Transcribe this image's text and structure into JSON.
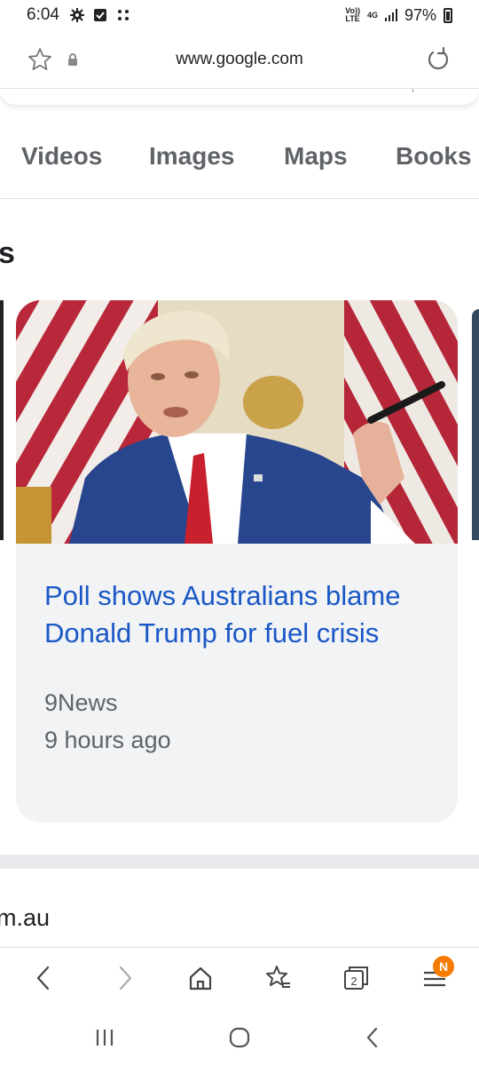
{
  "status_bar": {
    "time": "6:04",
    "network_top": "Vo))",
    "network_bottom": "LTE",
    "data_type": "4G",
    "battery": "97%",
    "icons": [
      "settings-icon",
      "checkbox-icon",
      "dots-icon",
      "signal-icon",
      "battery-icon"
    ]
  },
  "url_bar": {
    "url": "www.google.com",
    "icons": [
      "bookmark-star-icon",
      "lock-icon",
      "reload-icon"
    ]
  },
  "tabs": [
    {
      "label": "Videos"
    },
    {
      "label": "Images"
    },
    {
      "label": "Maps"
    },
    {
      "label": "Books"
    }
  ],
  "section_heading_fragment": "s",
  "news_card": {
    "title": "Poll shows Australians blame Donald Trump for fuel crisis",
    "source": "9News",
    "time": "9 hours ago",
    "image": "photo-of-man-in-blue-suit-holding-pen-before-flags"
  },
  "next_result_fragment": "m.au",
  "toolbar": {
    "tab_count": "2",
    "menu_badge": "N",
    "icons": [
      "back-icon",
      "forward-icon",
      "home-icon",
      "bookmarks-icon",
      "tabs-icon",
      "menu-icon"
    ]
  },
  "system_nav": {
    "icons": [
      "recents-icon",
      "home-circle-icon",
      "system-back-icon"
    ]
  },
  "colors": {
    "link_blue": "#1a57c6",
    "card_bg": "#f1f3f4",
    "badge_orange": "#f57c00",
    "muted_text": "#5f6368"
  }
}
